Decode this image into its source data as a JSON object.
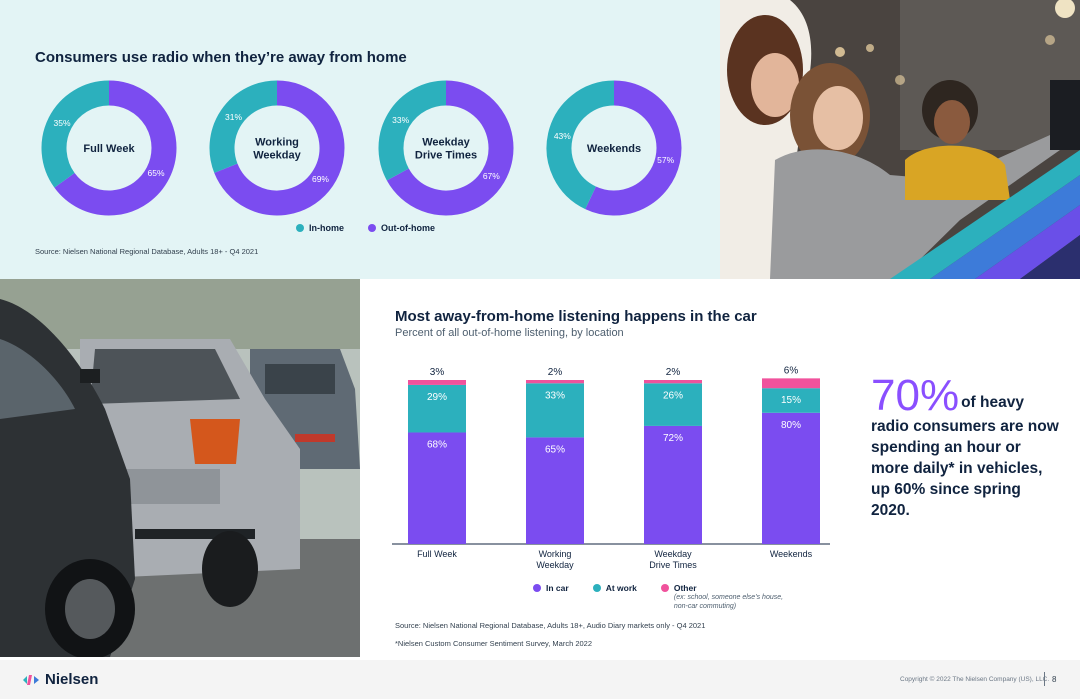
{
  "colors": {
    "in_home": "#2cb0bd",
    "out_of_home": "#7b4cf0",
    "in_car": "#7b4cf0",
    "at_work": "#2cb0bd",
    "other": "#f0529c",
    "accent_stat": "#8a4fff",
    "top_panel_bg": "#e3f4f5"
  },
  "donut_section": {
    "title": "Consumers use radio when they’re away from home",
    "legend": {
      "in_home": "In-home",
      "out_of_home": "Out-of-home"
    },
    "source": "Source: Nielsen National Regional Database, Adults 18+ - Q4 2021"
  },
  "bar_section": {
    "title": "Most away-from-home listening happens in the car",
    "subtitle": "Percent of all out-of-home listening, by location",
    "legend": {
      "in_car": "In car",
      "at_work": "At work",
      "other": "Other",
      "other_note": "(ex: school, someone else’s house, non-car commuting)"
    },
    "source": "Source: Nielsen National Regional Database, Adults 18+, Audio Diary markets only - Q4 2021",
    "footnote": "*Nielsen Custom Consumer Sentiment Survey, March 2022"
  },
  "stat": {
    "big": "70%",
    "text": "of heavy radio consumers are now spending an hour or more daily* in vehicles, up 60% since spring 2020."
  },
  "footer": {
    "logo": "Nielsen",
    "copyright": "Copyright © 2022 The Nielsen Company (US), LLC.",
    "page": "8"
  },
  "chart_data": [
    {
      "type": "pie",
      "variant": "donut",
      "title": "Consumers use radio when they’re away from home",
      "series": [
        {
          "name": "In-home"
        },
        {
          "name": "Out-of-home"
        }
      ],
      "charts": [
        {
          "label": [
            "Full Week"
          ],
          "in_home": 35,
          "out_of_home": 65,
          "in_home_label": "35%",
          "out_of_home_label": "65%"
        },
        {
          "label": [
            "Working",
            "Weekday"
          ],
          "in_home": 31,
          "out_of_home": 69,
          "in_home_label": "31%",
          "out_of_home_label": "69%"
        },
        {
          "label": [
            "Weekday",
            "Drive Times"
          ],
          "in_home": 33,
          "out_of_home": 67,
          "in_home_label": "33%",
          "out_of_home_label": "67%"
        },
        {
          "label": [
            "Weekends"
          ],
          "in_home": 43,
          "out_of_home": 57,
          "in_home_label": "43%",
          "out_of_home_label": "57%"
        }
      ]
    },
    {
      "type": "bar",
      "stacked": true,
      "title": "Most away-from-home listening happens in the car",
      "subtitle": "Percent of all out-of-home listening, by location",
      "categories": [
        [
          "Full Week"
        ],
        [
          "Working",
          "Weekday"
        ],
        [
          "Weekday",
          "Drive Times"
        ],
        [
          "Weekends"
        ]
      ],
      "series": [
        {
          "name": "In car",
          "values": [
            68,
            65,
            72,
            80
          ],
          "labels": [
            "68%",
            "65%",
            "72%",
            "80%"
          ]
        },
        {
          "name": "At work",
          "values": [
            29,
            33,
            26,
            15
          ],
          "labels": [
            "29%",
            "33%",
            "26%",
            "15%"
          ]
        },
        {
          "name": "Other",
          "values": [
            3,
            2,
            2,
            6
          ],
          "labels": [
            "3%",
            "2%",
            "2%",
            "6%"
          ]
        }
      ],
      "ylim": [
        0,
        100
      ],
      "grid": false
    }
  ]
}
